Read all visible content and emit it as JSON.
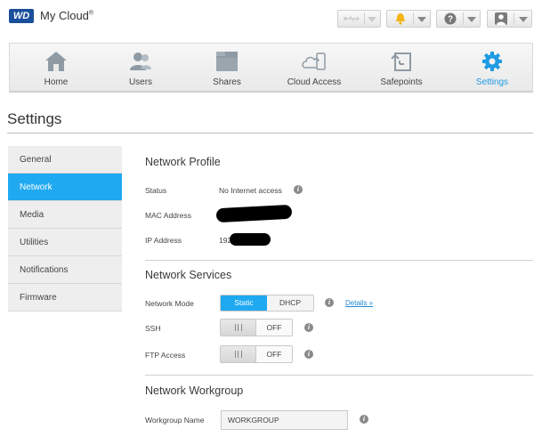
{
  "header": {
    "logo_text": "WD",
    "brand": "My Cloud",
    "brand_mark": "®",
    "buttons": [
      {
        "icon": "usb-icon"
      },
      {
        "icon": "bell-icon",
        "color": "#f2b417"
      },
      {
        "icon": "help-icon"
      },
      {
        "icon": "user-icon"
      }
    ]
  },
  "nav": {
    "items": [
      {
        "label": "Home",
        "icon": "home-icon"
      },
      {
        "label": "Users",
        "icon": "users-icon"
      },
      {
        "label": "Shares",
        "icon": "folder-icon"
      },
      {
        "label": "Cloud Access",
        "icon": "cloud-icon"
      },
      {
        "label": "Safepoints",
        "icon": "safepoint-icon"
      },
      {
        "label": "Settings",
        "icon": "gear-icon",
        "active": true
      }
    ]
  },
  "page": {
    "title": "Settings"
  },
  "sidebar": {
    "items": [
      {
        "label": "General"
      },
      {
        "label": "Network",
        "active": true
      },
      {
        "label": "Media"
      },
      {
        "label": "Utilities"
      },
      {
        "label": "Notifications"
      },
      {
        "label": "Firmware"
      }
    ]
  },
  "network_profile": {
    "title": "Network Profile",
    "status_label": "Status",
    "status_value": "No Internet access",
    "mac_label": "MAC Address",
    "ip_label": "IP Address",
    "ip_value_visible": "192"
  },
  "network_services": {
    "title": "Network Services",
    "mode_label": "Network Mode",
    "mode_options": [
      "Static",
      "DHCP"
    ],
    "mode_selected": "Static",
    "details_link": "Details »",
    "ssh_label": "SSH",
    "ssh_state": "OFF",
    "ftp_label": "FTP Access",
    "ftp_state": "OFF"
  },
  "network_workgroup": {
    "title": "Network Workgroup",
    "workgroup_label": "Workgroup Name",
    "workgroup_value": "WORKGROUP"
  },
  "colors": {
    "accent": "#1fa9f1",
    "logo": "#1a4f9c",
    "alert": "#f2b417"
  }
}
